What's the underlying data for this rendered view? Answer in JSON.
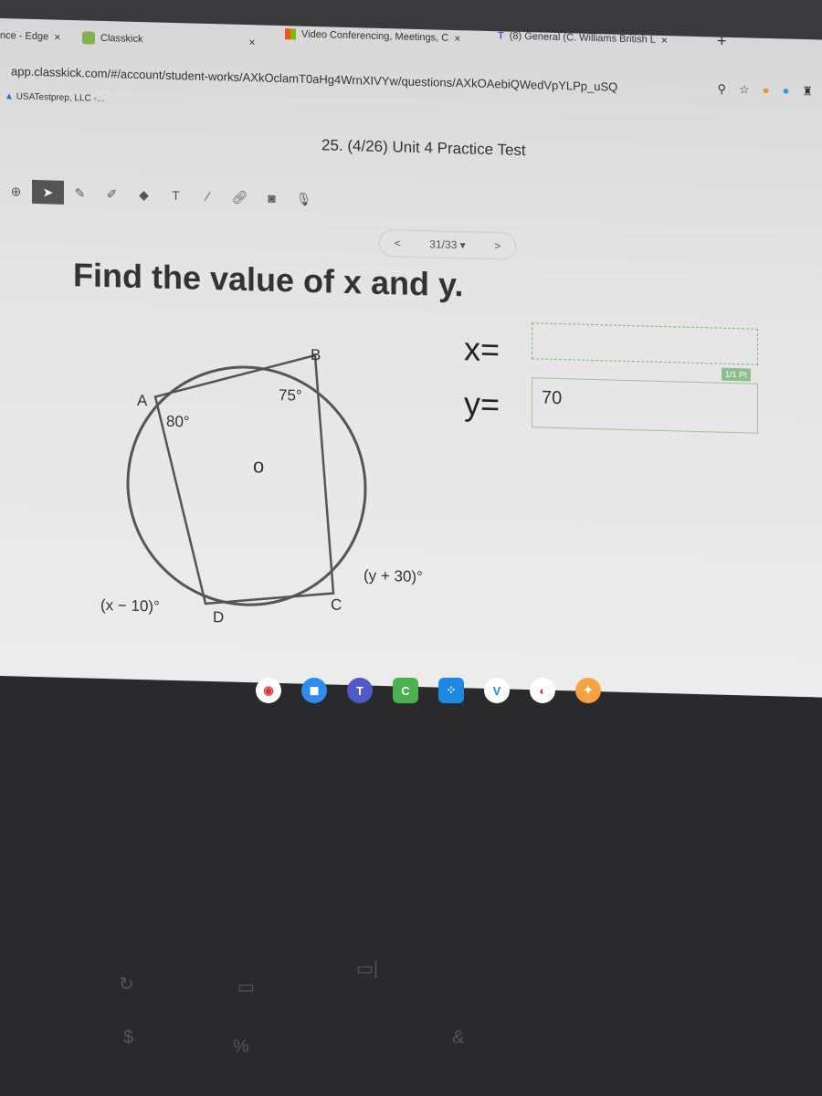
{
  "browser": {
    "tabs": [
      {
        "label": "nce - Edge",
        "icon": "edge-icon"
      },
      {
        "label": "Classkick",
        "icon": "classkick-icon"
      },
      {
        "label": "Video Conferencing, Meetings, C",
        "icon": "microsoft-icon"
      },
      {
        "label": "(8) General (C. Williams British L",
        "icon": "teams-icon"
      }
    ],
    "new_tab": "+",
    "url": "app.classkick.com/#/account/student-works/AXkOclamT0aHg4WrnXIVYw/questions/AXkOAebiQWedVpYLPp_uSQ",
    "bookmark": "USATestprep, LLC -..."
  },
  "page": {
    "title": "25. (4/26) Unit 4 Practice Test",
    "pager": {
      "prev": "<",
      "current": "31/33 ▾",
      "next": ">"
    },
    "question": "Find the value of x and y.",
    "diagram": {
      "A": "A",
      "B": "B",
      "C": "C",
      "D": "D",
      "angle_A": "80°",
      "angle_B": "75°",
      "angle_C": "(y + 30)°",
      "angle_D": "(x − 10)°"
    },
    "x_label": "x=",
    "x_value": "",
    "y_label": "y=",
    "y_value": "70",
    "points": "1/1 Pt"
  },
  "tools": [
    "zoom-icon",
    "pointer-icon",
    "pen-icon",
    "highlighter-icon",
    "eraser-icon",
    "text-icon",
    "line-icon",
    "link-icon",
    "camera-icon",
    "mic-icon"
  ]
}
